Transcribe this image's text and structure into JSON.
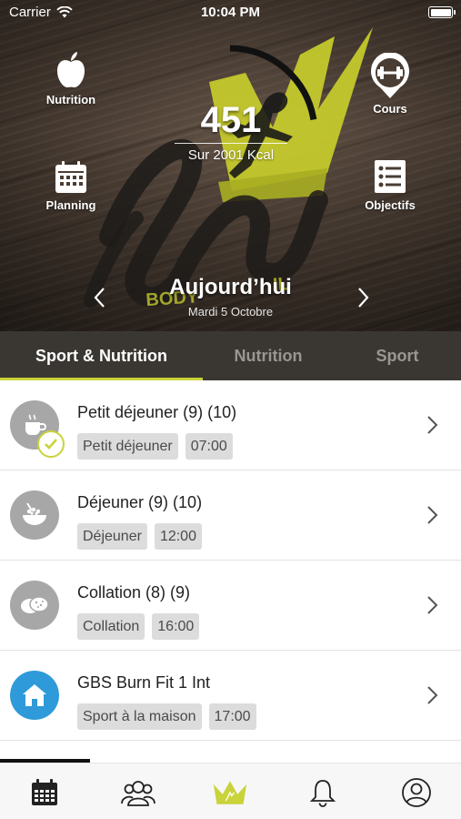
{
  "status_bar": {
    "carrier": "Carrier",
    "time": "10:04 PM"
  },
  "hero": {
    "nutrition_label": "Nutrition",
    "cours_label": "Cours",
    "planning_label": "Planning",
    "objectifs_label": "Objectifs",
    "kcal_consumed": "451",
    "kcal_target_text": "Sur 2001 Kcal",
    "kcal_progress_fraction": 0.225,
    "day_title": "Aujourd’hui",
    "day_date": "Mardi 5 Octobre"
  },
  "tabs": [
    {
      "label": "Sport & Nutrition",
      "active": true
    },
    {
      "label": "Nutrition",
      "active": false
    },
    {
      "label": "Sport",
      "active": false
    }
  ],
  "items": [
    {
      "title": "Petit déjeuner (9) (10)",
      "tags": [
        "Petit déjeuner",
        "07:00"
      ],
      "icon": "cup-icon",
      "completed": true
    },
    {
      "title": "Déjeuner (9) (10)",
      "tags": [
        "Déjeuner",
        "12:00"
      ],
      "icon": "bowl-icon",
      "completed": false
    },
    {
      "title": "Collation (8) (9)",
      "tags": [
        "Collation",
        "16:00"
      ],
      "icon": "cookies-icon",
      "completed": false
    },
    {
      "title": "GBS Burn Fit 1 Int",
      "tags": [
        "Sport à la maison",
        "17:00"
      ],
      "icon": "home-icon",
      "completed": false
    }
  ],
  "tabbar": {
    "items": [
      "calendar-icon",
      "group-icon",
      "crown-icon",
      "bell-icon",
      "profile-icon"
    ],
    "active_color": "#c9d33a"
  },
  "colors": {
    "accent": "#c9d33a",
    "tab_background": "#3a3733",
    "sport_icon_bg": "#2e9ad9",
    "meal_icon_bg": "#a7a7a7"
  }
}
